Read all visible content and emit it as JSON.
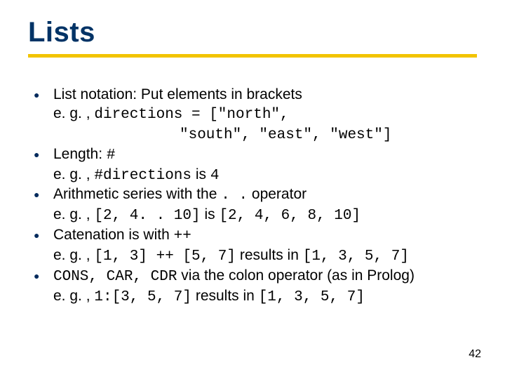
{
  "title": "Lists",
  "bullet_glyph": "●",
  "lines": {
    "b1_main": "List notation: Put elements in brackets",
    "b1_eg_prefix": "e. g. , ",
    "b1_code1": "directions = [\"north\",",
    "b1_code2": "\"south\", \"east\", \"west\"]",
    "b2_main_pre": "Length: ",
    "b2_main_sym": "#",
    "b2_eg_prefix": "e. g. , ",
    "b2_code1": "#directions",
    "b2_mid": " is ",
    "b2_code2": "4",
    "b3_main_pre": "Arithmetic series with the ",
    "b3_main_op": ". .",
    "b3_main_post": " operator",
    "b3_eg_prefix": "e. g. , ",
    "b3_code1": "[2, 4. . 10]",
    "b3_mid": " is ",
    "b3_code2": "[2, 4, 6, 8, 10]",
    "b4_main_pre": "Catenation is with ",
    "b4_main_op": "++",
    "b4_eg_prefix": "e. g. , ",
    "b4_code1": "[1, 3] ++ [5, 7]",
    "b4_mid": " results in ",
    "b4_code2": "[1, 3, 5, 7]",
    "b5_code_pre": "CONS, CAR, CDR",
    "b5_main_post": " via the colon operator (as in Prolog)",
    "b5_eg_prefix": "e. g. , ",
    "b5_code1": "1:[3, 5, 7]",
    "b5_mid": " results in ",
    "b5_code2": "[1, 3, 5, 7]"
  },
  "page_number": "42"
}
